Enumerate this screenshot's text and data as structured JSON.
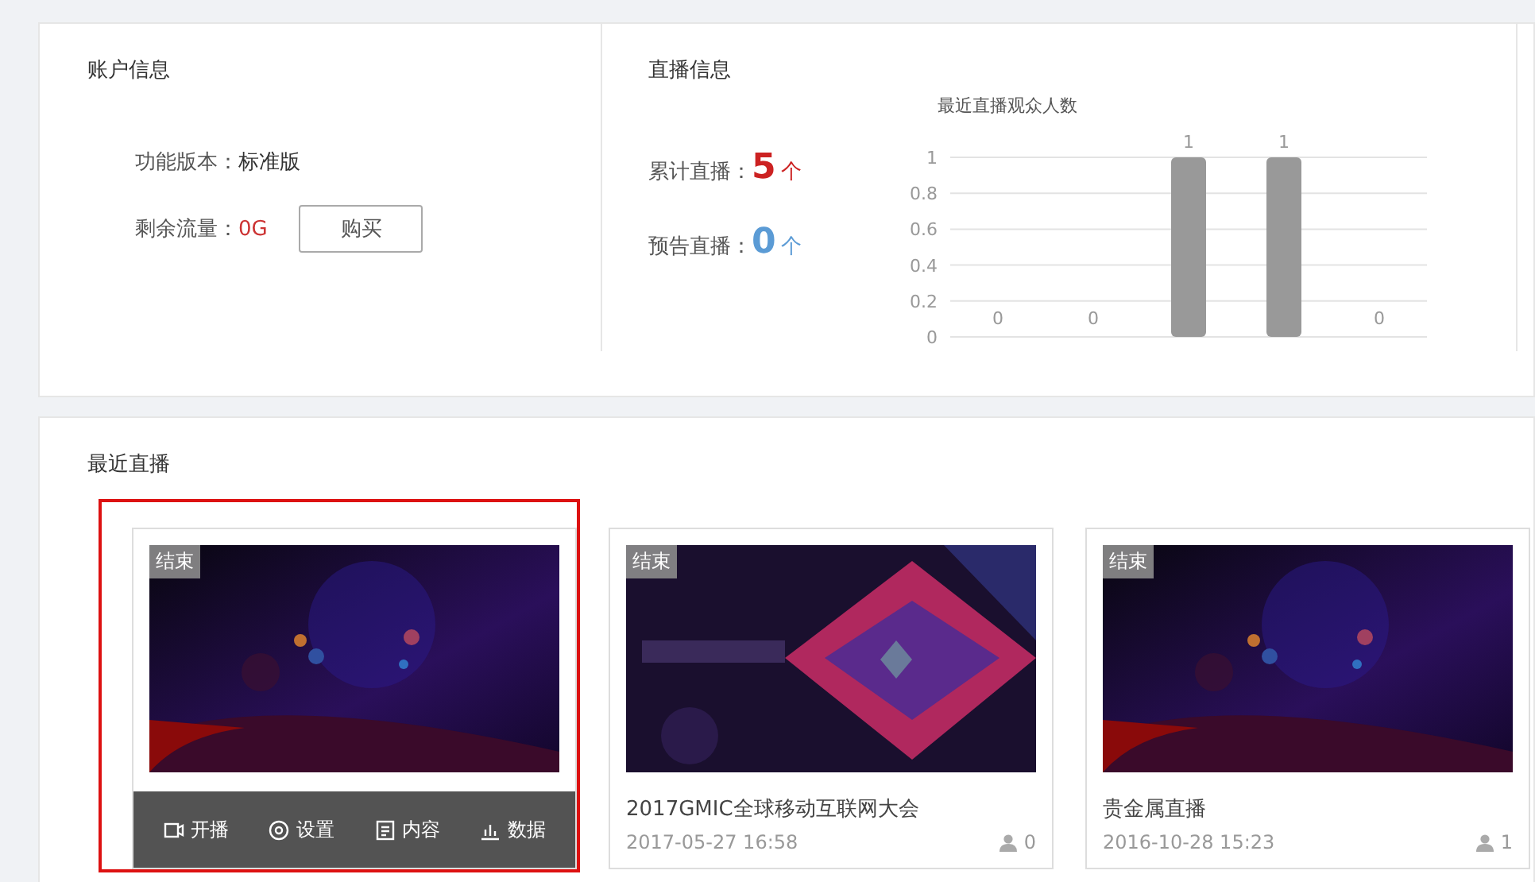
{
  "account": {
    "title": "账户信息",
    "rows": [
      {
        "label": "功能版本：",
        "value": "标准版"
      },
      {
        "label": "剩余流量：",
        "value": "0G",
        "button": "购买"
      }
    ]
  },
  "broadcast": {
    "title": "直播信息",
    "stats": [
      {
        "label": "累计直播：",
        "count": "5",
        "unit": "个",
        "color": "#cc2222"
      },
      {
        "label": "预告直播：",
        "count": "0",
        "unit": "个",
        "color": "#5b9bd5"
      }
    ],
    "chart": {
      "chart_data": {
        "type": "bar",
        "title": "最近直播观众人数",
        "values": [
          0,
          0,
          1,
          1,
          0
        ],
        "ylim": [
          0,
          1
        ],
        "yticks": [
          0,
          0.2,
          0.4,
          0.6,
          0.8,
          1
        ],
        "data_labels": true,
        "grid": true
      }
    }
  },
  "recent": {
    "title": "最近直播",
    "cards": [
      {
        "status": "结束",
        "highlighted": true,
        "actions": [
          {
            "kind": "video",
            "label": "开播"
          },
          {
            "kind": "settings",
            "label": "设置"
          },
          {
            "kind": "content",
            "label": "内容"
          },
          {
            "kind": "data",
            "label": "数据"
          }
        ]
      },
      {
        "status": "结束",
        "title": "2017GMIC全球移动互联网大会",
        "date": "2017-05-27 16:58",
        "viewers": "0",
        "highlighted": false
      },
      {
        "status": "结束",
        "title": "贵金属直播",
        "date": "2016-10-28 15:23",
        "viewers": "1",
        "highlighted": false
      }
    ]
  }
}
